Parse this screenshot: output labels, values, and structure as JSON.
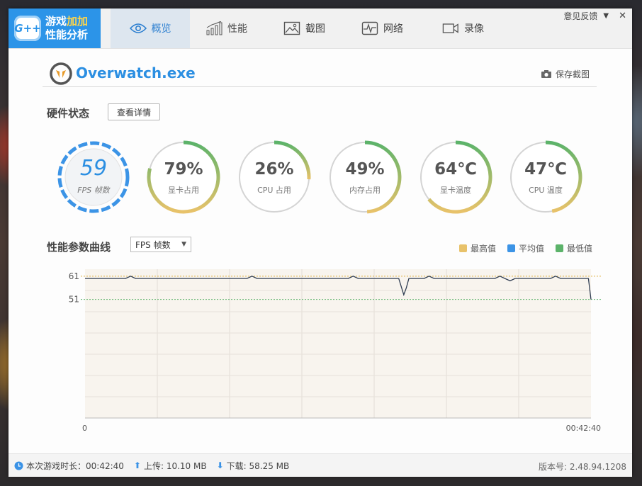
{
  "app": {
    "logo_badge": "G++",
    "logo_line1_a": "游戏",
    "logo_line1_b": "加加",
    "logo_line2": "性能分析"
  },
  "tabs": [
    {
      "label": "概览",
      "icon": "eye-icon"
    },
    {
      "label": "性能",
      "icon": "bar-chart-icon"
    },
    {
      "label": "截图",
      "icon": "picture-icon"
    },
    {
      "label": "网络",
      "icon": "pulse-icon"
    },
    {
      "label": "录像",
      "icon": "video-camera-icon"
    }
  ],
  "window": {
    "feedback": "意见反馈",
    "dropdown_glyph": "▼",
    "close_glyph": "✕"
  },
  "game": {
    "title": "Overwatch.exe",
    "save_screenshot": "保存截图"
  },
  "hardware": {
    "title": "硬件状态",
    "details_button": "查看详情",
    "fps": {
      "value": "59",
      "label": "FPS 帧数"
    },
    "gauges": [
      {
        "value": "79%",
        "label": "显卡占用",
        "fraction": 0.79
      },
      {
        "value": "26%",
        "label": "CPU 占用",
        "fraction": 0.26
      },
      {
        "value": "49%",
        "label": "内存占用",
        "fraction": 0.49
      },
      {
        "value": "64℃",
        "label": "显卡温度",
        "fraction": 0.64
      },
      {
        "value": "47℃",
        "label": "CPU 温度",
        "fraction": 0.47
      }
    ]
  },
  "curve": {
    "title": "性能参数曲线",
    "selected_metric": "FPS 帧数",
    "legend": [
      {
        "label": "最高值",
        "color": "#e8c26a"
      },
      {
        "label": "平均值",
        "color": "#3c94e6"
      },
      {
        "label": "最低值",
        "color": "#5cb36a"
      }
    ]
  },
  "chart_data": {
    "type": "line",
    "x_start_label": "0",
    "x_end_label": "00:42:40",
    "ytick_labels": [
      "61",
      "51"
    ],
    "ylim": [
      0,
      64
    ],
    "max_line": 61,
    "min_line": 51,
    "grid": true,
    "series": [
      {
        "x": [
          0,
          0.08,
          0.09,
          0.1,
          0.32,
          0.33,
          0.34,
          0.52,
          0.53,
          0.54,
          0.62,
          0.63,
          0.635,
          0.64,
          0.67,
          0.68,
          0.69,
          0.81,
          0.82,
          0.83,
          0.84,
          0.85,
          0.86,
          0.92,
          0.93,
          0.94,
          0.995,
          1
        ],
        "y": [
          60,
          60,
          61,
          60,
          60,
          61,
          60,
          60,
          61,
          60,
          60,
          53,
          56,
          60,
          60,
          61,
          60,
          60,
          61,
          60,
          59,
          60,
          60,
          60,
          61,
          60,
          60,
          51
        ]
      }
    ]
  },
  "status": {
    "playtime": "本次游戏时长：00:42:40",
    "upload": "上传: 10.10 MB",
    "download": "下载: 58.25 MB",
    "version": "版本号: 2.48.94.1208"
  },
  "colors": {
    "accent_blue": "#2c94e8",
    "gauge_track": "#d4d4d4",
    "gauge_green": "#5cb36a",
    "gauge_yellow": "#e8c26a",
    "chart_fill": "#f8f4ee",
    "chart_line": "#2f3d52"
  }
}
